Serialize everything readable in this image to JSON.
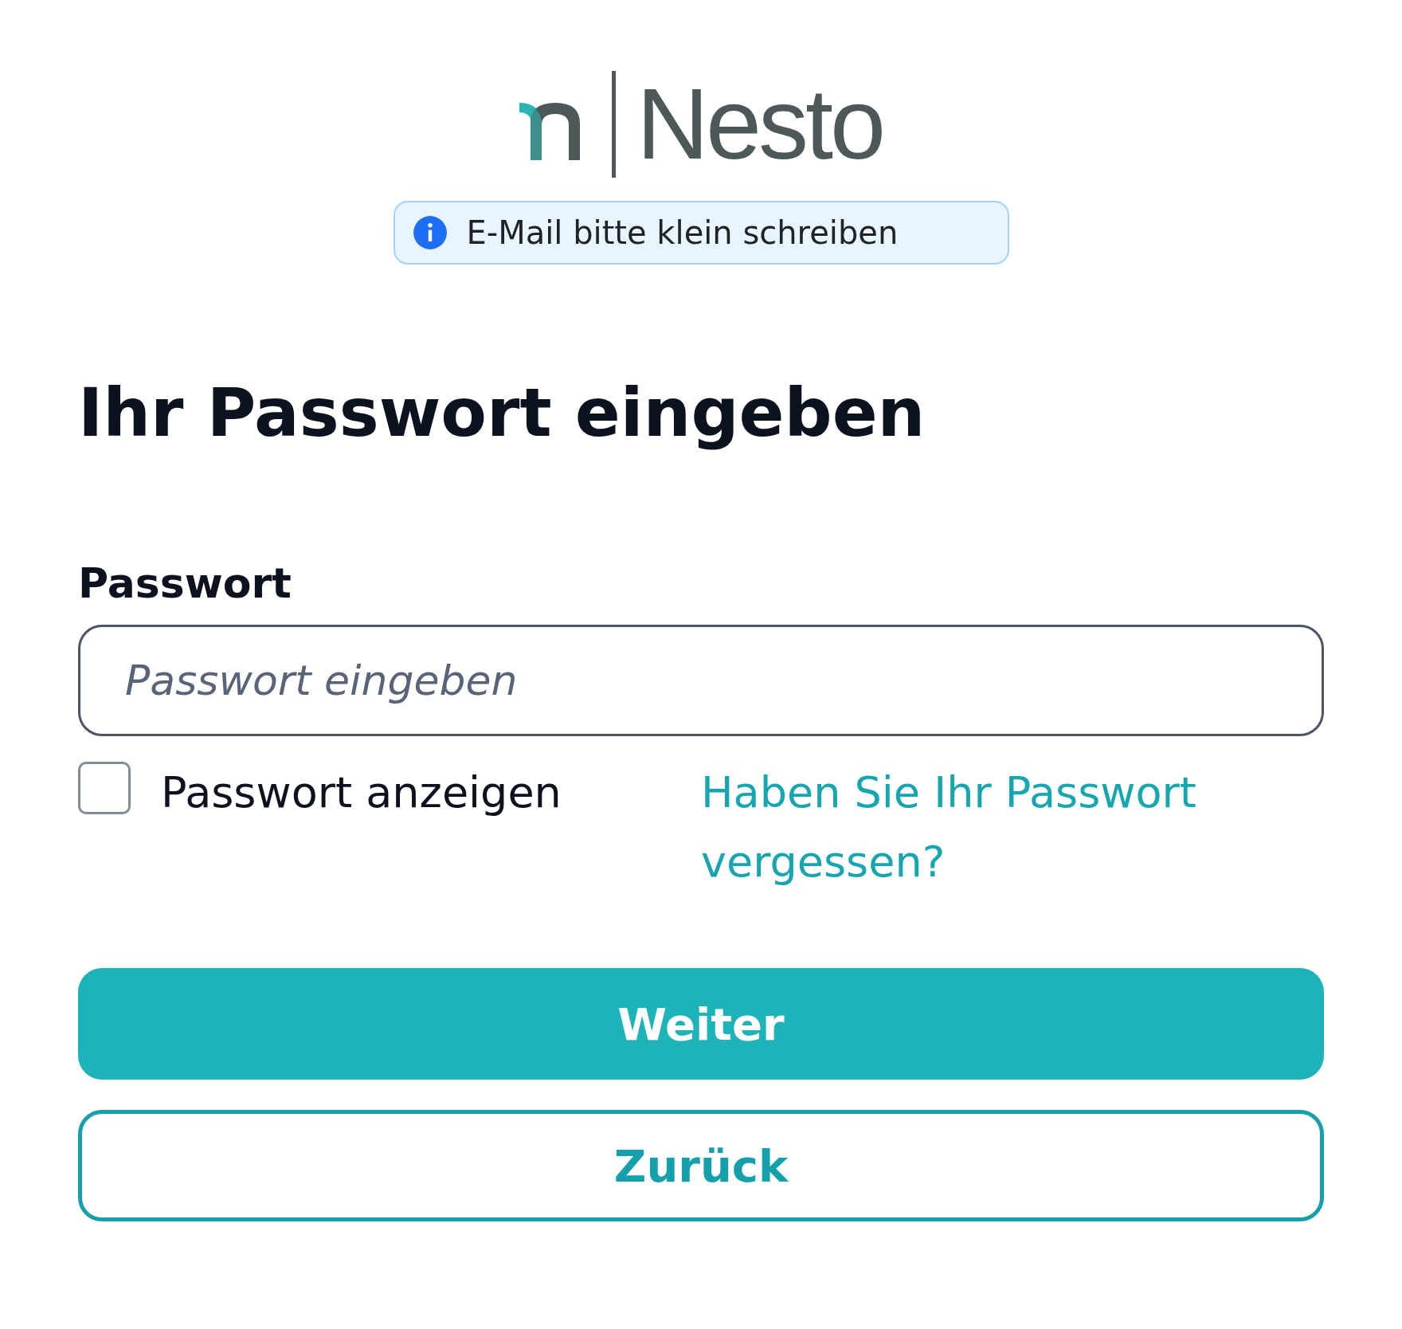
{
  "logo": {
    "wordmark": "Nesto"
  },
  "notice": {
    "kind": "info",
    "text": "E-Mail bitte klein schreiben"
  },
  "heading": "Ihr Passwort eingeben",
  "password": {
    "label": "Passwort",
    "placeholder": "Passwort eingeben"
  },
  "show_password": {
    "label": "Passwort anzeigen",
    "checked": false
  },
  "forgot_link": "Haben Sie Ihr Passwort vergessen?",
  "buttons": [
    {
      "label": "Weiter",
      "kind": "primary"
    },
    {
      "label": "Zurück",
      "kind": "secondary"
    }
  ]
}
